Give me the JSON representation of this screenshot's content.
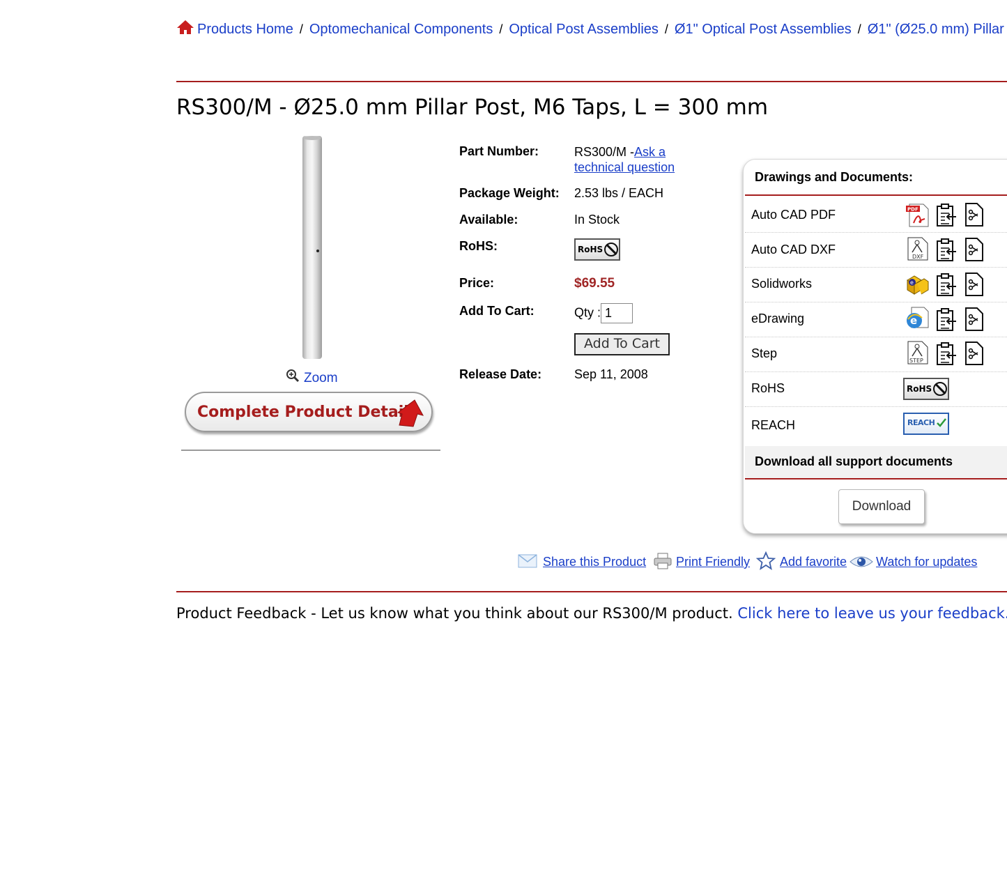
{
  "breadcrumb": {
    "items": [
      "Products Home",
      "Optomechanical Components",
      "Optical Post Assemblies",
      "Ø1\" Optical Post Assemblies",
      "Ø1\" (Ø25.0 mm) Pillar"
    ],
    "separator": "/"
  },
  "product": {
    "title": "RS300/M - Ø25.0 mm Pillar Post, M6 Taps, L = 300 mm",
    "zoom_label": "Zoom",
    "details_button": "Complete Product Details"
  },
  "specs": {
    "part_number_label": "Part Number:",
    "part_number": "RS300/M -",
    "ask_link_line1": "Ask a",
    "ask_link_line2": "technical question",
    "weight_label": "Package Weight:",
    "weight": "2.53 lbs / EACH",
    "available_label": "Available:",
    "available": "In Stock",
    "rohs_label": "RoHS:",
    "rohs_badge": "RoHS",
    "price_label": "Price:",
    "price": "$69.55",
    "cart_label": "Add To Cart:",
    "qty_label": "Qty :",
    "qty_value": "1",
    "cart_button": "Add To Cart",
    "release_label": "Release Date:",
    "release_date": "Sep 11, 2008"
  },
  "documents": {
    "title": "Drawings and Documents:",
    "rows": [
      "Auto CAD PDF",
      "Auto CAD DXF",
      "Solidworks",
      "eDrawing",
      "Step",
      "RoHS",
      "REACH"
    ],
    "pdf_tag": "PDF",
    "dxf_tag": "DXF",
    "step_tag": "STEP",
    "rohs_badge": "RoHS",
    "reach_badge": "REACH",
    "all_docs_label": "Download all support documents",
    "download_button": "Download"
  },
  "share": {
    "share_label": "Share this Product",
    "print_label": "Print Friendly",
    "favorite_label": "Add favorite",
    "watch_label": "Watch for updates"
  },
  "feedback": {
    "text": "Product Feedback - Let us know what you think about our RS300/M product.",
    "link": "Click here to leave us your feedback."
  },
  "colors": {
    "link": "#1a3ec8",
    "accent_red": "#a51d1d",
    "price": "#a02626"
  }
}
